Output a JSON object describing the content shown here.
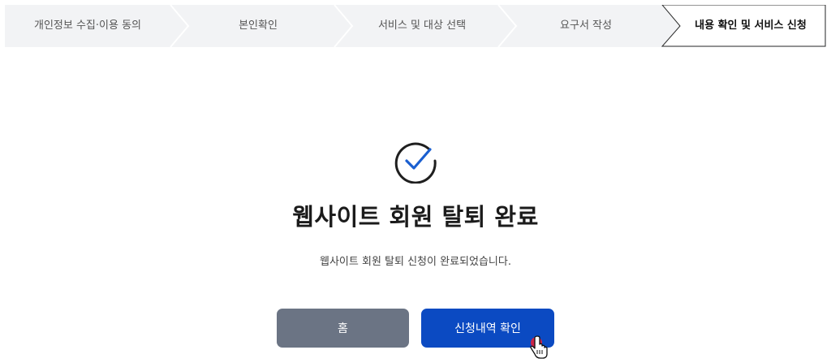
{
  "steps": [
    {
      "label": "개인정보 수집·이용 동의",
      "active": false
    },
    {
      "label": "본인확인",
      "active": false
    },
    {
      "label": "서비스 및 대상 선택",
      "active": false
    },
    {
      "label": "요구서 작성",
      "active": false
    },
    {
      "label": "내용 확인 및 서비스 신청",
      "active": true
    }
  ],
  "result": {
    "title": "웹사이트 회원 탈퇴 완료",
    "description": "웹사이트 회원 탈퇴 신청이 완료되었습니다."
  },
  "buttons": {
    "home_label": "홈",
    "check_label": "신청내역 확인"
  },
  "colors": {
    "step_bg": "#f2f3f5",
    "step_active_bg": "#ffffff",
    "home_button": "#6b7484",
    "primary_button": "#0b4ac2",
    "check_accent": "#1a5fd0"
  }
}
